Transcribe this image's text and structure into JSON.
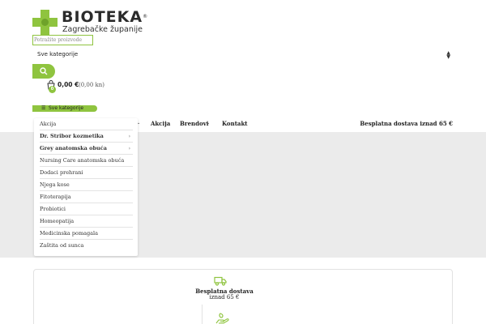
{
  "brand": {
    "name": "BIOTEKA",
    "registered": "®",
    "tagline": "Zagrebačke županije"
  },
  "search": {
    "placeholder": "Potražite proizvode",
    "category_value": "Sve kategorije"
  },
  "cart": {
    "count": "0",
    "price_eur": "0,00 €",
    "price_kn": "(0,00 kn)"
  },
  "all_categories_label": "Sve kategorije",
  "nav": {
    "items": [
      {
        "label": "Akcija"
      },
      {
        "label": "Brendovi"
      },
      {
        "label": "Kontakt"
      }
    ],
    "free_shipping": "Besplatna dostava iznad 65 €"
  },
  "dropdown": {
    "items": [
      {
        "label": "Akcija"
      },
      {
        "label": "Dr. Stribor kozmetika"
      },
      {
        "label": "Grey anatomska obuća"
      },
      {
        "label": "Nursing Care anatomska obuća"
      },
      {
        "label": "Dodaci prehrani"
      },
      {
        "label": "Njega kose"
      },
      {
        "label": "Fitoterapija"
      },
      {
        "label": "Probiotici"
      },
      {
        "label": "Homeopatija"
      },
      {
        "label": "Medicinska pomagala"
      },
      {
        "label": "Zaštita od sunca"
      }
    ]
  },
  "features": {
    "shipping_title": "Besplatna dostava",
    "shipping_sub": "iznad 65 €"
  },
  "colors": {
    "accent": "#8fc43f",
    "hero_bg": "#ebebeb"
  },
  "icons": {
    "search": "search-icon",
    "cart": "cart-icon",
    "menu": "menu-icon",
    "truck": "truck-icon"
  }
}
